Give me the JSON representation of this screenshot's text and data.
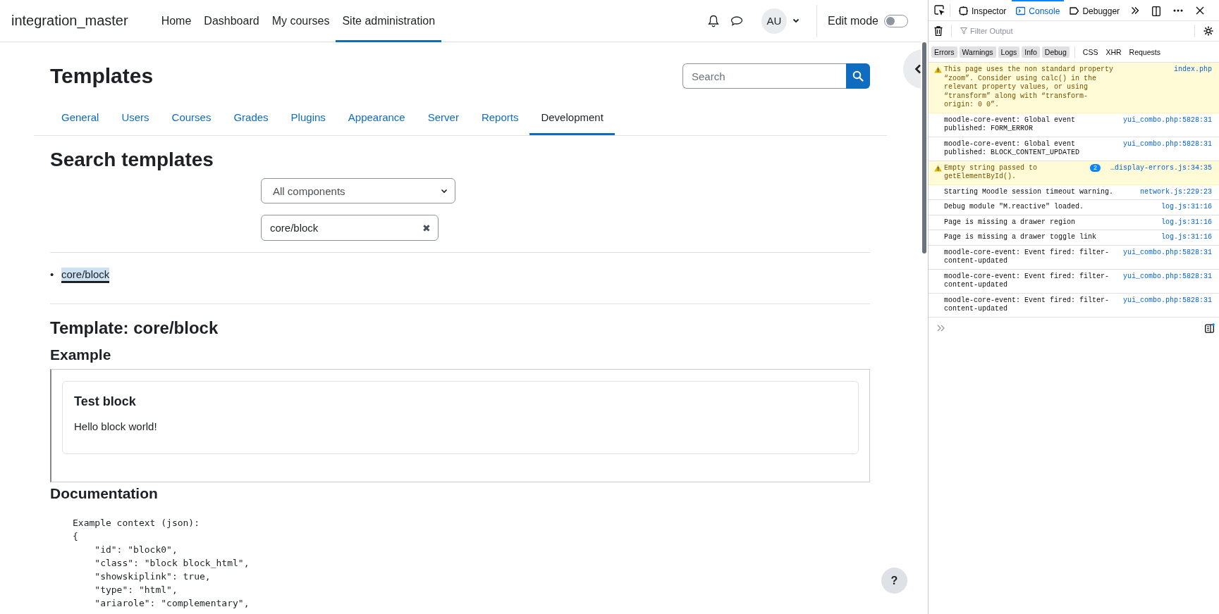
{
  "header": {
    "brand": "integration_master",
    "nav": [
      {
        "label": "Home",
        "selected": false
      },
      {
        "label": "Dashboard",
        "selected": false
      },
      {
        "label": "My courses",
        "selected": false
      },
      {
        "label": "Site administration",
        "selected": true
      }
    ],
    "avatar": "AU",
    "edit_mode": {
      "label": "Edit mode",
      "on": false
    }
  },
  "page": {
    "title": "Templates",
    "search": {
      "placeholder": "Search"
    },
    "tabs": [
      {
        "label": "General",
        "selected": false
      },
      {
        "label": "Users",
        "selected": false
      },
      {
        "label": "Courses",
        "selected": false
      },
      {
        "label": "Grades",
        "selected": false
      },
      {
        "label": "Plugins",
        "selected": false
      },
      {
        "label": "Appearance",
        "selected": false
      },
      {
        "label": "Server",
        "selected": false
      },
      {
        "label": "Reports",
        "selected": false
      },
      {
        "label": "Development",
        "selected": true
      }
    ],
    "section_title": "Search templates",
    "component_select": {
      "value": "All components"
    },
    "filter": {
      "value": "core/block",
      "clear": "✖"
    },
    "results": [
      {
        "marker": "•",
        "label": "core/block",
        "selected": true
      }
    ],
    "template_title": "Template: core/block",
    "example_heading": "Example",
    "example_block": {
      "title": "Test block",
      "body": "Hello block world!"
    },
    "documentation_heading": "Documentation",
    "code_lines": [
      "Example context (json):",
      "{",
      "    \"id\": \"block0\",",
      "    \"class\": \"block block_html\",",
      "    \"showskiplink\": true,",
      "    \"type\": \"html\",",
      "    \"ariarole\": \"complementary\","
    ]
  },
  "help_button": "?",
  "devtools": {
    "tabs": [
      {
        "label": "Inspector",
        "selected": false
      },
      {
        "label": "Console",
        "selected": true
      },
      {
        "label": "Debugger",
        "selected": false
      }
    ],
    "filter_placeholder": "Filter Output",
    "filters": [
      {
        "label": "Errors",
        "selected": true
      },
      {
        "label": "Warnings",
        "selected": true
      },
      {
        "label": "Logs",
        "selected": true
      },
      {
        "label": "Info",
        "selected": true
      },
      {
        "label": "Debug",
        "selected": true
      },
      {
        "label": "CSS",
        "selected": false
      },
      {
        "label": "XHR",
        "selected": false
      },
      {
        "label": "Requests",
        "selected": false
      }
    ],
    "messages": [
      {
        "kind": "warning",
        "text": "This page uses the non standard property “zoom”. Consider using calc() in the relevant property values, or using “transform” along with “transform-origin: 0 0”.",
        "source": "index.php"
      },
      {
        "kind": "log",
        "text": "moodle-core-event: Global event published: FORM_ERROR",
        "source": "yui_combo.php:5828:31"
      },
      {
        "kind": "log",
        "text": "moodle-core-event: Global event published: BLOCK_CONTENT_UPDATED",
        "source": "yui_combo.php:5828:31"
      },
      {
        "kind": "warning",
        "text": "Empty string passed to getElementById().",
        "source": "…display-errors.js:34:35",
        "count": "2"
      },
      {
        "kind": "log",
        "text": "Starting Moodle session timeout warning.",
        "source": "network.js:229:23"
      },
      {
        "kind": "log",
        "text": "Debug module \"M.reactive\" loaded.",
        "source": "log.js:31:16"
      },
      {
        "kind": "log",
        "text": "Page is missing a drawer region",
        "source": "log.js:31:16"
      },
      {
        "kind": "log",
        "text": "Page is missing a drawer toggle link",
        "source": "log.js:31:16"
      },
      {
        "kind": "log",
        "text": "moodle-core-event: Event fired: filter-content-updated",
        "source": "yui_combo.php:5828:31"
      },
      {
        "kind": "log",
        "text": "moodle-core-event: Event fired: filter-content-updated",
        "source": "yui_combo.php:5828:31"
      },
      {
        "kind": "log",
        "text": "moodle-core-event: Event fired: filter-content-updated",
        "source": "yui_combo.php:5828:31"
      }
    ]
  }
}
